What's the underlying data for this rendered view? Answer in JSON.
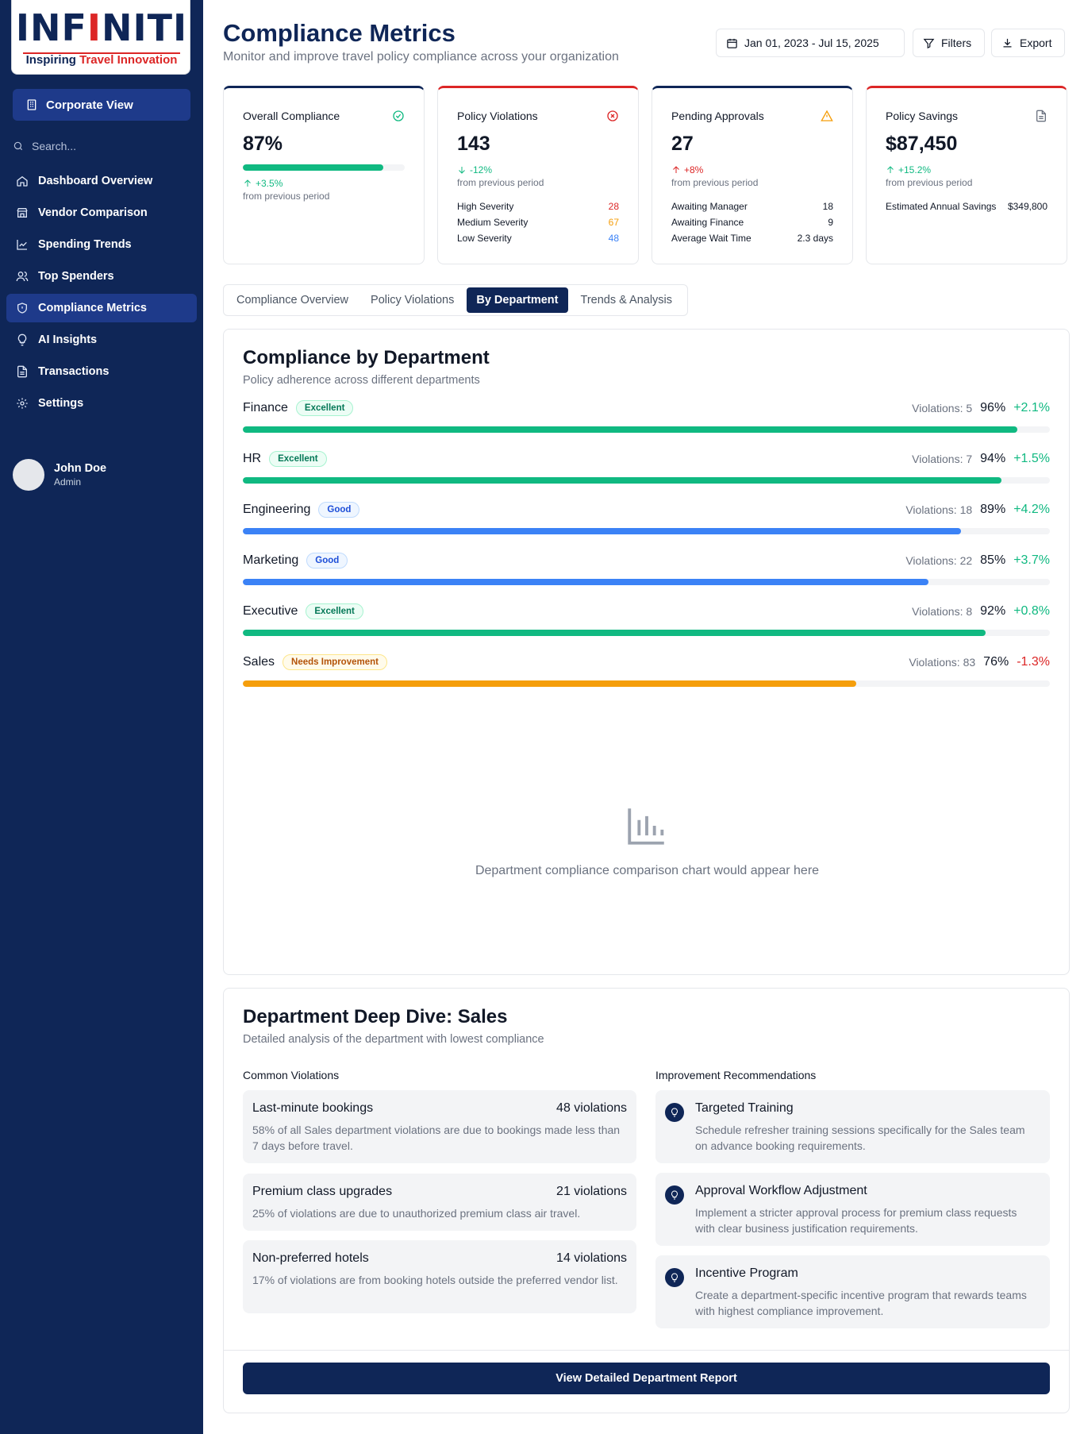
{
  "brand": {
    "logo_text_a": "INF",
    "logo_text_dot": "I",
    "logo_text_b": "NITI",
    "tagline_a": "Inspiring ",
    "tagline_b": "Travel Innovation"
  },
  "sidebar": {
    "view_button": "Corporate View",
    "search_placeholder": "Search...",
    "items": [
      {
        "label": "Dashboard Overview",
        "icon": "home-icon"
      },
      {
        "label": "Vendor Comparison",
        "icon": "store-icon"
      },
      {
        "label": "Spending Trends",
        "icon": "line-chart-icon"
      },
      {
        "label": "Top Spenders",
        "icon": "users-icon"
      },
      {
        "label": "Compliance Metrics",
        "icon": "shield-icon",
        "active": true
      },
      {
        "label": "AI Insights",
        "icon": "lightbulb-icon"
      },
      {
        "label": "Transactions",
        "icon": "document-icon"
      },
      {
        "label": "Settings",
        "icon": "gear-icon"
      }
    ],
    "user": {
      "name": "John Doe",
      "role": "Admin"
    }
  },
  "header": {
    "title": "Compliance Metrics",
    "subtitle": "Monitor and improve travel policy compliance across your organization",
    "date_range": "Jan 01, 2023 - Jul 15, 2025",
    "filters_label": "Filters",
    "export_label": "Export"
  },
  "metrics": {
    "overall": {
      "title": "Overall Compliance",
      "value": "87%",
      "progress": 0.87,
      "delta": "+3.5%",
      "from": "from previous period"
    },
    "violations": {
      "title": "Policy Violations",
      "value": "143",
      "delta": "-12%",
      "from": "from previous period",
      "rows": [
        {
          "label": "High Severity",
          "value": "28",
          "color": "#dc2626"
        },
        {
          "label": "Medium Severity",
          "value": "67",
          "color": "#f59e0b"
        },
        {
          "label": "Low Severity",
          "value": "48",
          "color": "#3b82f6"
        }
      ]
    },
    "approvals": {
      "title": "Pending Approvals",
      "value": "27",
      "delta": "+8%",
      "from": "from previous period",
      "rows": [
        {
          "label": "Awaiting Manager",
          "value": "18"
        },
        {
          "label": "Awaiting Finance",
          "value": "9"
        },
        {
          "label": "Average Wait Time",
          "value": "2.3 days"
        }
      ]
    },
    "savings": {
      "title": "Policy Savings",
      "value": "$87,450",
      "delta": "+15.2%",
      "from": "from previous period",
      "rows": [
        {
          "label": "Estimated Annual Savings",
          "value": "$349,800"
        }
      ]
    }
  },
  "tabs": [
    {
      "label": "Compliance Overview"
    },
    {
      "label": "Policy Violations"
    },
    {
      "label": "By Department",
      "active": true
    },
    {
      "label": "Trends & Analysis"
    }
  ],
  "departments": {
    "title": "Compliance by Department",
    "subtitle": "Policy adherence across different departments",
    "items": [
      {
        "name": "Finance",
        "badge": "Excellent",
        "violations": "Violations: 5",
        "percent": "96%",
        "change": "+2.1%",
        "value": 0.96,
        "color": "#10b981"
      },
      {
        "name": "HR",
        "badge": "Excellent",
        "violations": "Violations: 7",
        "percent": "94%",
        "change": "+1.5%",
        "value": 0.94,
        "color": "#10b981"
      },
      {
        "name": "Engineering",
        "badge": "Good",
        "violations": "Violations: 18",
        "percent": "89%",
        "change": "+4.2%",
        "value": 0.89,
        "color": "#3b82f6"
      },
      {
        "name": "Marketing",
        "badge": "Good",
        "violations": "Violations: 22",
        "percent": "85%",
        "change": "+3.7%",
        "value": 0.85,
        "color": "#3b82f6"
      },
      {
        "name": "Executive",
        "badge": "Excellent",
        "violations": "Violations: 8",
        "percent": "92%",
        "change": "+0.8%",
        "value": 0.92,
        "color": "#10b981"
      },
      {
        "name": "Sales",
        "badge": "Needs Improvement",
        "violations": "Violations: 83",
        "percent": "76%",
        "change": "-1.3%",
        "value": 0.76,
        "color": "#f59e0b"
      }
    ],
    "placeholder": "Department compliance comparison chart would appear here"
  },
  "deep_dive": {
    "title": "Department Deep Dive: Sales",
    "subtitle": "Detailed analysis of the department with lowest compliance",
    "violations_head": "Common Violations",
    "recs_head": "Improvement Recommendations",
    "violations": [
      {
        "title": "Last-minute bookings",
        "count": "48 violations",
        "desc": "58% of all Sales department violations are due to bookings made less than 7 days before travel."
      },
      {
        "title": "Premium class upgrades",
        "count": "21 violations",
        "desc": "25% of violations are due to unauthorized premium class air travel."
      },
      {
        "title": "Non-preferred hotels",
        "count": "14 violations",
        "desc": "17% of violations are from booking hotels outside the preferred vendor list."
      }
    ],
    "recommendations": [
      {
        "title": "Targeted Training",
        "desc": "Schedule refresher training sessions specifically for the Sales team on advance booking requirements."
      },
      {
        "title": "Approval Workflow Adjustment",
        "desc": "Implement a stricter approval process for premium class requests with clear business justification requirements."
      },
      {
        "title": "Incentive Program",
        "desc": "Create a department-specific incentive program that rewards teams with highest compliance improvement."
      }
    ],
    "button": "View Detailed Department Report"
  }
}
